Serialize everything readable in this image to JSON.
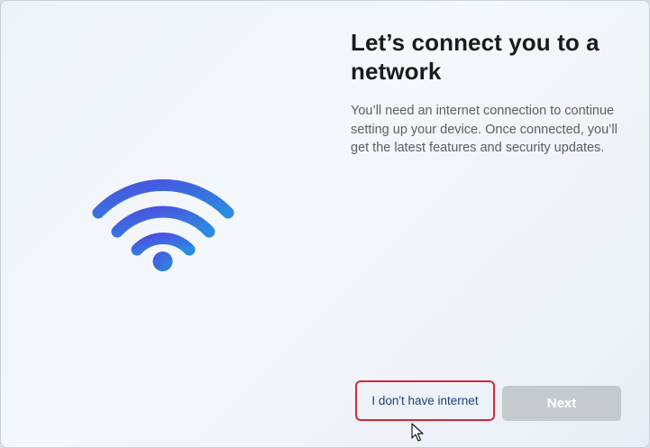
{
  "page": {
    "title": "Let’s connect you to a network",
    "description": "You’ll need an internet connection to continue setting up your device. Once connected, you’ll get the latest features and security updates."
  },
  "illustration": {
    "icon": "wifi-icon",
    "gradient_start": "#4a5be0",
    "gradient_end": "#2a8de0"
  },
  "actions": {
    "no_internet_label": "I don't have internet",
    "next_label": "Next",
    "next_enabled": false
  },
  "colors": {
    "highlight_border": "#d72835",
    "link_text": "#1a3f7a",
    "disabled_button": "#c6c9cd"
  }
}
